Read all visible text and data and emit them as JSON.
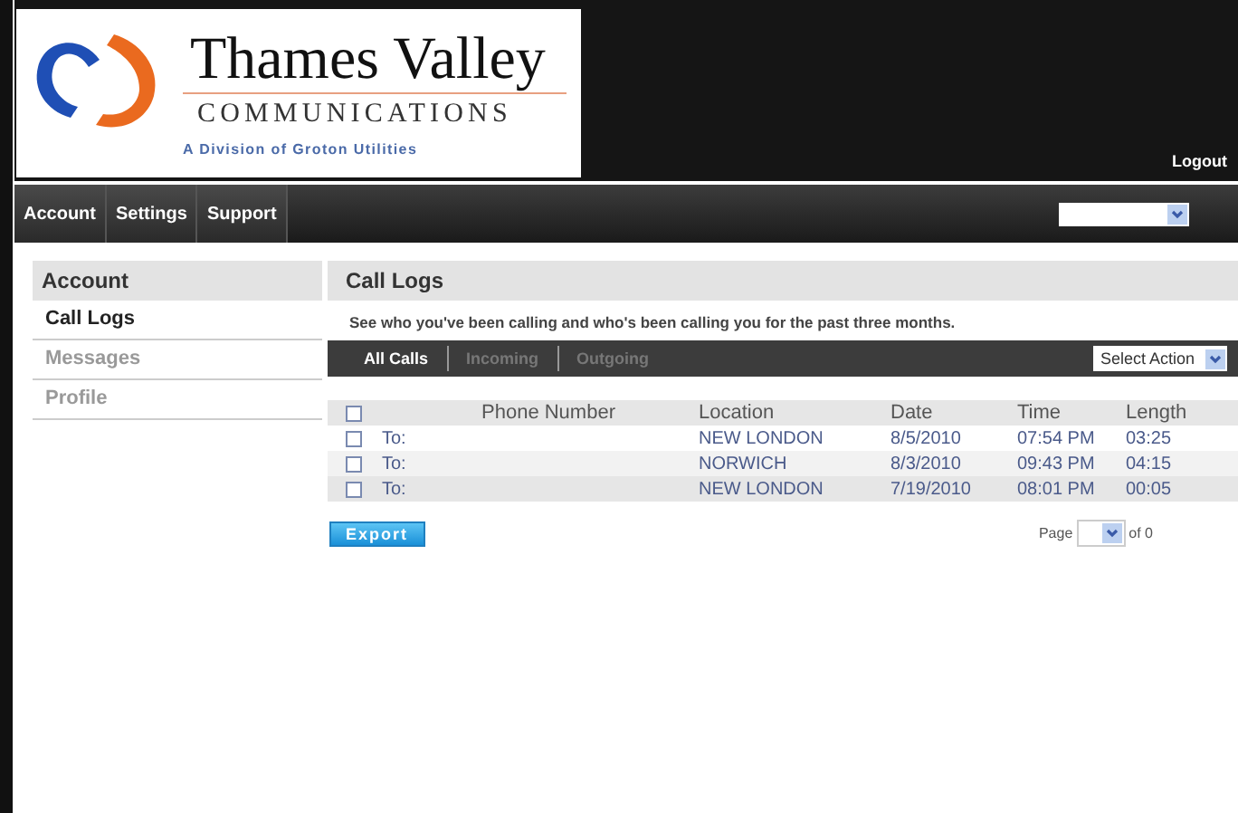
{
  "header": {
    "logo": {
      "name": "Thames Valley",
      "subtitle": "COMMUNICATIONS",
      "division": "A Division of Groton Utilities"
    },
    "logout": "Logout"
  },
  "nav": {
    "items": [
      {
        "label": "Account"
      },
      {
        "label": "Settings"
      },
      {
        "label": "Support"
      }
    ]
  },
  "sidebar": {
    "title": "Account",
    "items": [
      {
        "label": "Call Logs",
        "selected": true
      },
      {
        "label": "Messages",
        "selected": false
      },
      {
        "label": "Profile",
        "selected": false
      }
    ]
  },
  "main": {
    "title": "Call Logs",
    "description": "See who you've been calling and who's been calling you for the past three months.",
    "filter_tabs": [
      {
        "label": "All Calls",
        "selected": true
      },
      {
        "label": "Incoming",
        "selected": false
      },
      {
        "label": "Outgoing",
        "selected": false
      }
    ],
    "action_select": {
      "value": "Select Action"
    },
    "table": {
      "header_checked": false,
      "columns": [
        "Phone Number",
        "Location",
        "Date",
        "Time",
        "Length"
      ],
      "rows": [
        {
          "checked": false,
          "direction": "To:",
          "location": "NEW LONDON",
          "date": "8/5/2010",
          "time": "07:54 PM",
          "length": "03:25"
        },
        {
          "checked": false,
          "direction": "To:",
          "location": "NORWICH",
          "date": "8/3/2010",
          "time": "09:43 PM",
          "length": "04:15"
        },
        {
          "checked": false,
          "direction": "To:",
          "location": "NEW LONDON",
          "date": "7/19/2010",
          "time": "08:01 PM",
          "length": "00:05"
        }
      ]
    },
    "export_button": "Export",
    "pager": {
      "label": "Page",
      "suffix": "of 0"
    }
  }
}
